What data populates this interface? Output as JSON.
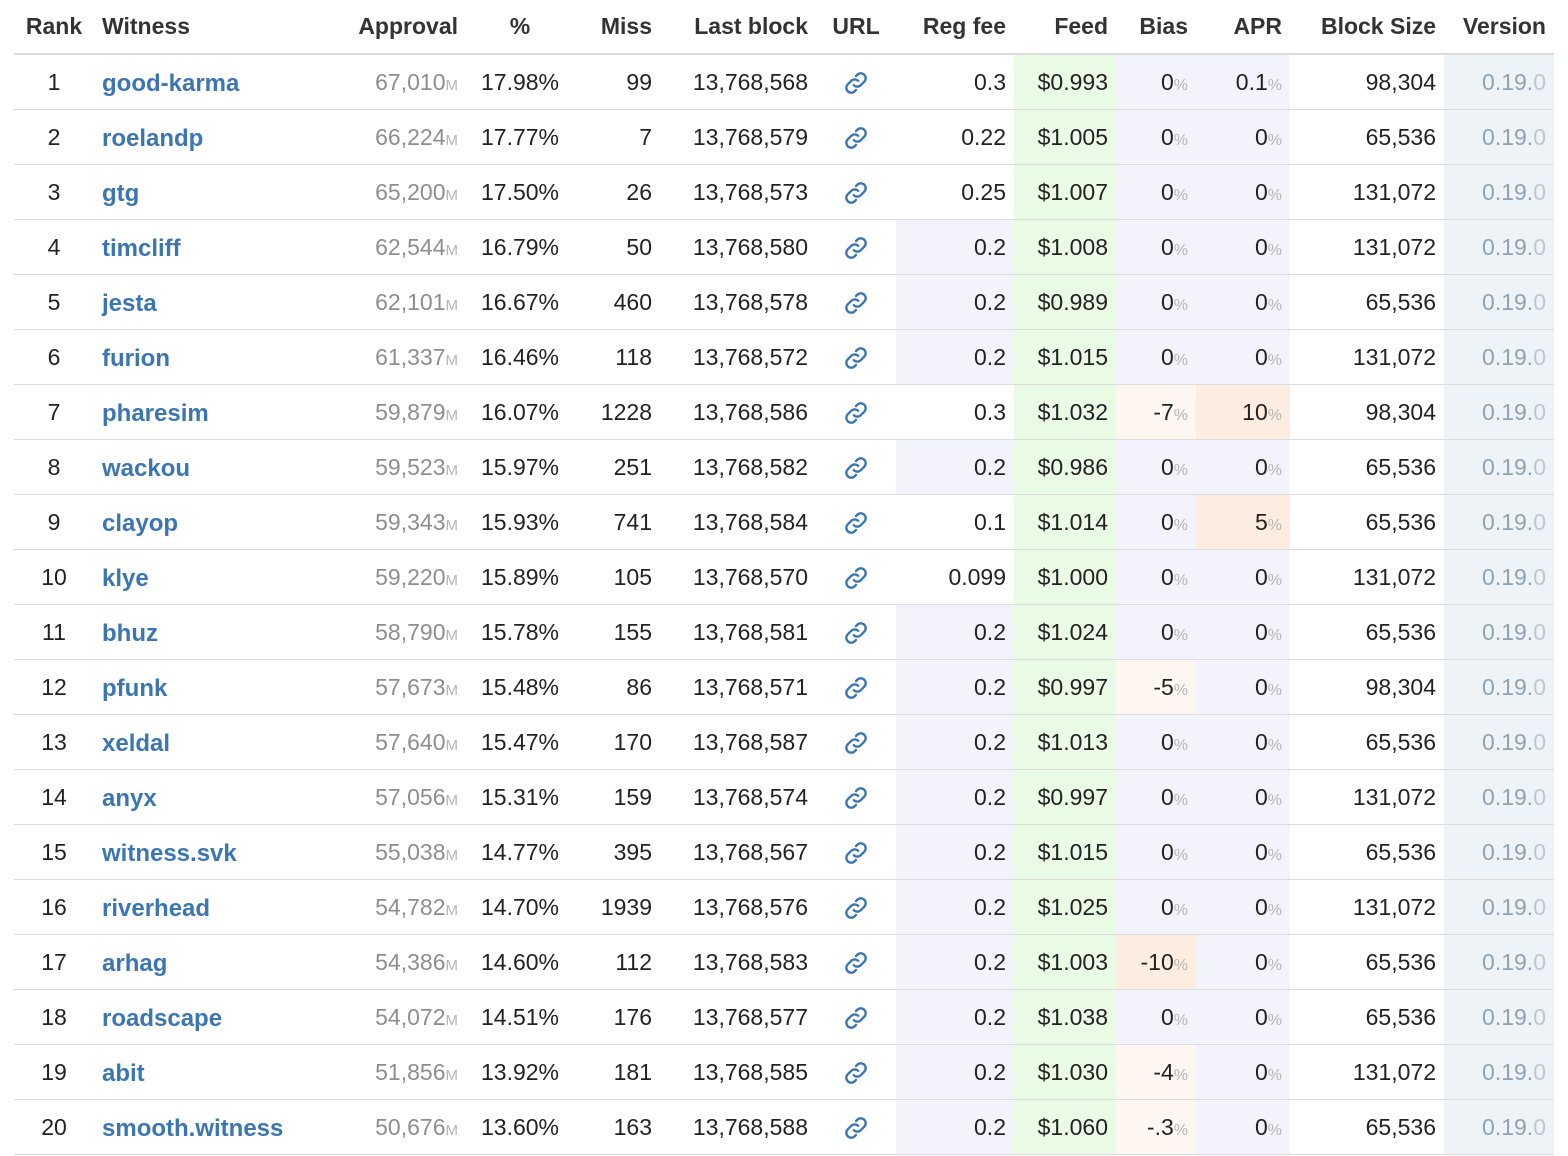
{
  "headers": {
    "rank": "Rank",
    "witness": "Witness",
    "approval": "Approval",
    "pct": "%",
    "miss": "Miss",
    "last_block": "Last block",
    "url": "URL",
    "reg_fee": "Reg fee",
    "feed": "Feed",
    "bias": "Bias",
    "apr": "APR",
    "block_size": "Block Size",
    "version": "Version"
  },
  "units": {
    "approval": "M",
    "percent": "%"
  },
  "icons": {
    "url": "link-icon"
  },
  "colors": {
    "link": "#3c76b2",
    "feed_bg": "#e9fbe4",
    "version_bg": "#eef3f7",
    "shade_bg": "#f3f3fd",
    "warm_bg": "#fdece0"
  },
  "rows": [
    {
      "rank": "1",
      "witness": "good-karma",
      "approval": "67,010",
      "pct": "17.98%",
      "miss": "99",
      "last_block": "13,768,568",
      "reg_fee": "0.3",
      "feed": "$0.993",
      "bias": "0",
      "apr": "0.1",
      "block_size": "98,304",
      "version_main": "0.19.",
      "version_minor": "0",
      "fee_shaded": false,
      "bias_shaded": true,
      "apr_shaded": true,
      "bias_warm": "",
      "apr_warm": ""
    },
    {
      "rank": "2",
      "witness": "roelandp",
      "approval": "66,224",
      "pct": "17.77%",
      "miss": "7",
      "last_block": "13,768,579",
      "reg_fee": "0.22",
      "feed": "$1.005",
      "bias": "0",
      "apr": "0",
      "block_size": "65,536",
      "version_main": "0.19.",
      "version_minor": "0",
      "fee_shaded": false,
      "bias_shaded": true,
      "apr_shaded": true,
      "bias_warm": "",
      "apr_warm": ""
    },
    {
      "rank": "3",
      "witness": "gtg",
      "approval": "65,200",
      "pct": "17.50%",
      "miss": "26",
      "last_block": "13,768,573",
      "reg_fee": "0.25",
      "feed": "$1.007",
      "bias": "0",
      "apr": "0",
      "block_size": "131,072",
      "version_main": "0.19.",
      "version_minor": "0",
      "fee_shaded": false,
      "bias_shaded": true,
      "apr_shaded": true,
      "bias_warm": "",
      "apr_warm": ""
    },
    {
      "rank": "4",
      "witness": "timcliff",
      "approval": "62,544",
      "pct": "16.79%",
      "miss": "50",
      "last_block": "13,768,580",
      "reg_fee": "0.2",
      "feed": "$1.008",
      "bias": "0",
      "apr": "0",
      "block_size": "131,072",
      "version_main": "0.19.",
      "version_minor": "0",
      "fee_shaded": true,
      "bias_shaded": true,
      "apr_shaded": true,
      "bias_warm": "",
      "apr_warm": ""
    },
    {
      "rank": "5",
      "witness": "jesta",
      "approval": "62,101",
      "pct": "16.67%",
      "miss": "460",
      "last_block": "13,768,578",
      "reg_fee": "0.2",
      "feed": "$0.989",
      "bias": "0",
      "apr": "0",
      "block_size": "65,536",
      "version_main": "0.19.",
      "version_minor": "0",
      "fee_shaded": true,
      "bias_shaded": true,
      "apr_shaded": true,
      "bias_warm": "",
      "apr_warm": ""
    },
    {
      "rank": "6",
      "witness": "furion",
      "approval": "61,337",
      "pct": "16.46%",
      "miss": "118",
      "last_block": "13,768,572",
      "reg_fee": "0.2",
      "feed": "$1.015",
      "bias": "0",
      "apr": "0",
      "block_size": "131,072",
      "version_main": "0.19.",
      "version_minor": "0",
      "fee_shaded": true,
      "bias_shaded": true,
      "apr_shaded": true,
      "bias_warm": "",
      "apr_warm": ""
    },
    {
      "rank": "7",
      "witness": "pharesim",
      "approval": "59,879",
      "pct": "16.07%",
      "miss": "1228",
      "last_block": "13,768,586",
      "reg_fee": "0.3",
      "feed": "$1.032",
      "bias": "-7",
      "apr": "10",
      "block_size": "98,304",
      "version_main": "0.19.",
      "version_minor": "0",
      "fee_shaded": false,
      "bias_shaded": true,
      "apr_shaded": true,
      "bias_warm": "light",
      "apr_warm": "strong"
    },
    {
      "rank": "8",
      "witness": "wackou",
      "approval": "59,523",
      "pct": "15.97%",
      "miss": "251",
      "last_block": "13,768,582",
      "reg_fee": "0.2",
      "feed": "$0.986",
      "bias": "0",
      "apr": "0",
      "block_size": "65,536",
      "version_main": "0.19.",
      "version_minor": "0",
      "fee_shaded": true,
      "bias_shaded": true,
      "apr_shaded": true,
      "bias_warm": "",
      "apr_warm": ""
    },
    {
      "rank": "9",
      "witness": "clayop",
      "approval": "59,343",
      "pct": "15.93%",
      "miss": "741",
      "last_block": "13,768,584",
      "reg_fee": "0.1",
      "feed": "$1.014",
      "bias": "0",
      "apr": "5",
      "block_size": "65,536",
      "version_main": "0.19.",
      "version_minor": "0",
      "fee_shaded": false,
      "bias_shaded": true,
      "apr_shaded": true,
      "bias_warm": "",
      "apr_warm": "strong"
    },
    {
      "rank": "10",
      "witness": "klye",
      "approval": "59,220",
      "pct": "15.89%",
      "miss": "105",
      "last_block": "13,768,570",
      "reg_fee": "0.099",
      "feed": "$1.000",
      "bias": "0",
      "apr": "0",
      "block_size": "131,072",
      "version_main": "0.19.",
      "version_minor": "0",
      "fee_shaded": false,
      "bias_shaded": true,
      "apr_shaded": true,
      "bias_warm": "",
      "apr_warm": ""
    },
    {
      "rank": "11",
      "witness": "bhuz",
      "approval": "58,790",
      "pct": "15.78%",
      "miss": "155",
      "last_block": "13,768,581",
      "reg_fee": "0.2",
      "feed": "$1.024",
      "bias": "0",
      "apr": "0",
      "block_size": "65,536",
      "version_main": "0.19.",
      "version_minor": "0",
      "fee_shaded": true,
      "bias_shaded": true,
      "apr_shaded": true,
      "bias_warm": "",
      "apr_warm": ""
    },
    {
      "rank": "12",
      "witness": "pfunk",
      "approval": "57,673",
      "pct": "15.48%",
      "miss": "86",
      "last_block": "13,768,571",
      "reg_fee": "0.2",
      "feed": "$0.997",
      "bias": "-5",
      "apr": "0",
      "block_size": "98,304",
      "version_main": "0.19.",
      "version_minor": "0",
      "fee_shaded": true,
      "bias_shaded": true,
      "apr_shaded": true,
      "bias_warm": "light",
      "apr_warm": ""
    },
    {
      "rank": "13",
      "witness": "xeldal",
      "approval": "57,640",
      "pct": "15.47%",
      "miss": "170",
      "last_block": "13,768,587",
      "reg_fee": "0.2",
      "feed": "$1.013",
      "bias": "0",
      "apr": "0",
      "block_size": "65,536",
      "version_main": "0.19.",
      "version_minor": "0",
      "fee_shaded": true,
      "bias_shaded": true,
      "apr_shaded": true,
      "bias_warm": "",
      "apr_warm": ""
    },
    {
      "rank": "14",
      "witness": "anyx",
      "approval": "57,056",
      "pct": "15.31%",
      "miss": "159",
      "last_block": "13,768,574",
      "reg_fee": "0.2",
      "feed": "$0.997",
      "bias": "0",
      "apr": "0",
      "block_size": "131,072",
      "version_main": "0.19.",
      "version_minor": "0",
      "fee_shaded": true,
      "bias_shaded": true,
      "apr_shaded": true,
      "bias_warm": "",
      "apr_warm": ""
    },
    {
      "rank": "15",
      "witness": "witness.svk",
      "approval": "55,038",
      "pct": "14.77%",
      "miss": "395",
      "last_block": "13,768,567",
      "reg_fee": "0.2",
      "feed": "$1.015",
      "bias": "0",
      "apr": "0",
      "block_size": "65,536",
      "version_main": "0.19.",
      "version_minor": "0",
      "fee_shaded": true,
      "bias_shaded": true,
      "apr_shaded": true,
      "bias_warm": "",
      "apr_warm": ""
    },
    {
      "rank": "16",
      "witness": "riverhead",
      "approval": "54,782",
      "pct": "14.70%",
      "miss": "1939",
      "last_block": "13,768,576",
      "reg_fee": "0.2",
      "feed": "$1.025",
      "bias": "0",
      "apr": "0",
      "block_size": "131,072",
      "version_main": "0.19.",
      "version_minor": "0",
      "fee_shaded": true,
      "bias_shaded": true,
      "apr_shaded": true,
      "bias_warm": "",
      "apr_warm": ""
    },
    {
      "rank": "17",
      "witness": "arhag",
      "approval": "54,386",
      "pct": "14.60%",
      "miss": "112",
      "last_block": "13,768,583",
      "reg_fee": "0.2",
      "feed": "$1.003",
      "bias": "-10",
      "apr": "0",
      "block_size": "65,536",
      "version_main": "0.19.",
      "version_minor": "0",
      "fee_shaded": true,
      "bias_shaded": true,
      "apr_shaded": true,
      "bias_warm": "strong",
      "apr_warm": ""
    },
    {
      "rank": "18",
      "witness": "roadscape",
      "approval": "54,072",
      "pct": "14.51%",
      "miss": "176",
      "last_block": "13,768,577",
      "reg_fee": "0.2",
      "feed": "$1.038",
      "bias": "0",
      "apr": "0",
      "block_size": "65,536",
      "version_main": "0.19.",
      "version_minor": "0",
      "fee_shaded": true,
      "bias_shaded": true,
      "apr_shaded": true,
      "bias_warm": "",
      "apr_warm": ""
    },
    {
      "rank": "19",
      "witness": "abit",
      "approval": "51,856",
      "pct": "13.92%",
      "miss": "181",
      "last_block": "13,768,585",
      "reg_fee": "0.2",
      "feed": "$1.030",
      "bias": "-4",
      "apr": "0",
      "block_size": "131,072",
      "version_main": "0.19.",
      "version_minor": "0",
      "fee_shaded": true,
      "bias_shaded": true,
      "apr_shaded": true,
      "bias_warm": "light",
      "apr_warm": ""
    },
    {
      "rank": "20",
      "witness": "smooth.witness",
      "approval": "50,676",
      "pct": "13.60%",
      "miss": "163",
      "last_block": "13,768,588",
      "reg_fee": "0.2",
      "feed": "$1.060",
      "bias": "-.3",
      "apr": "0",
      "block_size": "65,536",
      "version_main": "0.19.",
      "version_minor": "0",
      "fee_shaded": true,
      "bias_shaded": true,
      "apr_shaded": true,
      "bias_warm": "light",
      "apr_warm": ""
    }
  ]
}
